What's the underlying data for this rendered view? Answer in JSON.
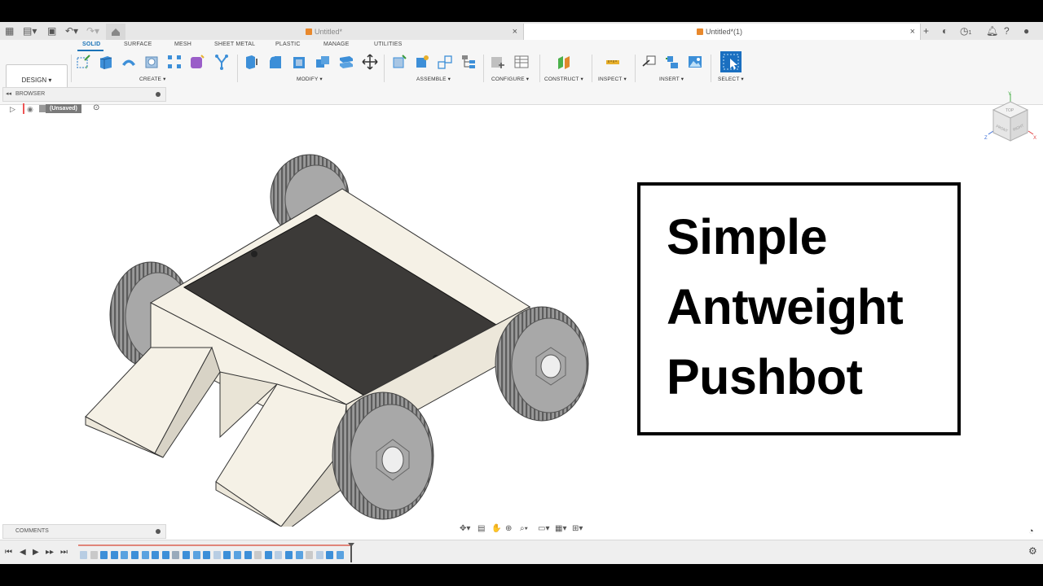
{
  "document_tabs": [
    {
      "label": "Untitled*",
      "active": false
    },
    {
      "label": "Untitled*(1)",
      "active": true
    }
  ],
  "notifications_count": "1",
  "ribbon": {
    "workspace": "DESIGN",
    "tabs": [
      "SOLID",
      "SURFACE",
      "MESH",
      "SHEET METAL",
      "PLASTIC",
      "MANAGE",
      "UTILITIES"
    ],
    "active_tab": "SOLID",
    "groups": [
      "CREATE ▾",
      "MODIFY ▾",
      "ASSEMBLE ▾",
      "CONFIGURE ▾",
      "CONSTRUCT ▾",
      "INSPECT ▾",
      "INSERT ▾",
      "SELECT ▾"
    ]
  },
  "browser": {
    "title": "BROWSER",
    "root_label": "(Unsaved)"
  },
  "comments": {
    "title": "COMMENTS"
  },
  "viewcube": {
    "faces": [
      "TOP",
      "FRONT",
      "RIGHT"
    ],
    "axes": [
      "Y",
      "Z",
      "X"
    ]
  },
  "canvas_title": {
    "line1": "Simple",
    "line2": "Antweight",
    "line3": "Pushbot"
  },
  "colors": {
    "ribbon_accent": "#1a73b8",
    "document_icon": "#e8882c",
    "robot_body": "#f5f1e6",
    "robot_top_plate": "#3c3a38",
    "wheel": "#999999",
    "timeline_marker": "#e0857a"
  }
}
